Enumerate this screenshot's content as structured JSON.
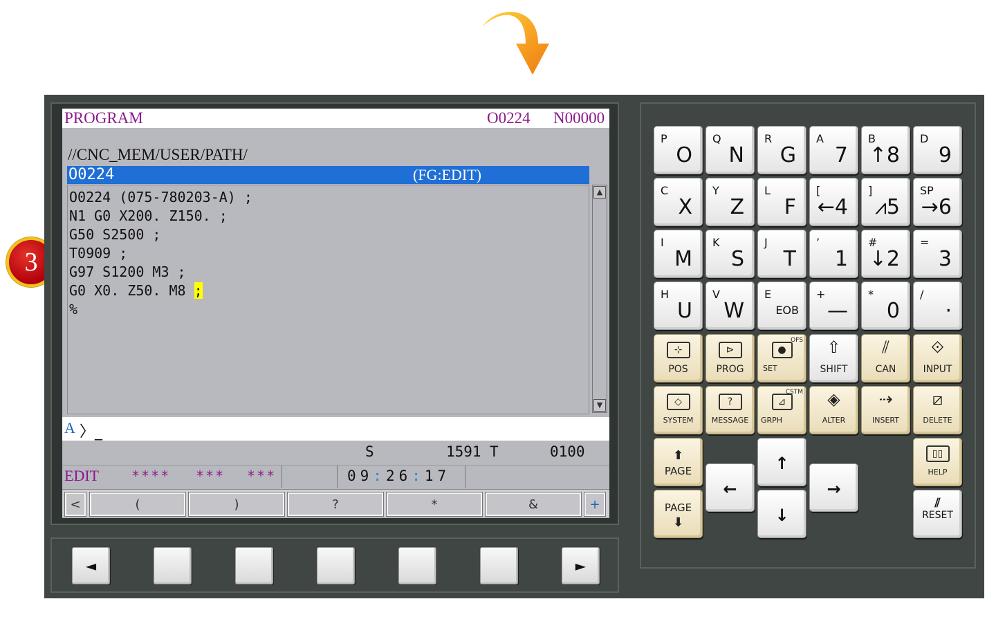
{
  "step_number": "3",
  "lcd": {
    "title": "PROGRAM",
    "o_number": "O0224",
    "n_number": "N00000",
    "path": "//CNC_MEM/USER/PATH/",
    "selected_program": "O0224",
    "mode_tag": "(FG:EDIT)",
    "code_lines": [
      "O0224 (075-780203-A) ;",
      "N1 G0 X200. Z150. ;",
      "G50 S2500 ;",
      "T0909 ;",
      "G97 S1200 M3 ;",
      "G0 X0. Z50. M8 ",
      "%"
    ],
    "cursor_char": ";",
    "input_prompt": "A",
    "input_rest": "〉_",
    "s_label": "S",
    "s_value": "1591",
    "t_label": "T",
    "t_value": "0100",
    "mode": "EDIT",
    "status_a": "****",
    "status_b": "***",
    "status_c": "***",
    "clock_h": "09",
    "clock_m": "26",
    "clock_s": "17",
    "soft_keys": [
      "<",
      "(",
      ")",
      "?",
      "*",
      "&",
      "+"
    ]
  },
  "hard_soft_keys": [
    "◄",
    "",
    "",
    "",
    "",
    "",
    "►"
  ],
  "keys": {
    "row1": [
      {
        "sub": "P",
        "main": "O"
      },
      {
        "sub": "Q",
        "main": "N"
      },
      {
        "sub": "R",
        "main": "G"
      },
      {
        "sub": "A",
        "main": "7"
      },
      {
        "sub": "B",
        "main": "↑8"
      },
      {
        "sub": "D",
        "main": "9"
      }
    ],
    "row2": [
      {
        "sub": "C",
        "main": "X"
      },
      {
        "sub": "Y",
        "main": "Z"
      },
      {
        "sub": "L",
        "main": "F"
      },
      {
        "sub": "[",
        "main": "←4"
      },
      {
        "sub": "]",
        "main": "⩘5"
      },
      {
        "sub": "SP",
        "main": "→6"
      }
    ],
    "row3": [
      {
        "sub": "I",
        "main": "M"
      },
      {
        "sub": "K",
        "main": "S"
      },
      {
        "sub": "J",
        "main": "T"
      },
      {
        "sub": "’",
        "main": "1"
      },
      {
        "sub": "#",
        "main": "↓2"
      },
      {
        "sub": "=",
        "main": "3"
      }
    ],
    "row4": [
      {
        "sub": "H",
        "main": "U"
      },
      {
        "sub": "V",
        "main": "W"
      },
      {
        "sub": "E",
        "main": "EOB"
      },
      {
        "sub": "+",
        "main": "—"
      },
      {
        "sub": "*",
        "main": "0"
      },
      {
        "sub": "/",
        "main": "·"
      }
    ],
    "func1": [
      "POS",
      "PROG",
      "SET",
      "SHIFT",
      "CAN",
      "INPUT"
    ],
    "func1_corner_ofs": "OFS",
    "func2": [
      "SYSTEM",
      "MESSAGE",
      "GRPH",
      "ALTER",
      "INSERT",
      "DELETE"
    ],
    "func2_corner_cstm": "CSTM",
    "page_up": "PAGE",
    "page_down": "PAGE",
    "help": "HELP",
    "reset": "RESET"
  },
  "colors": {
    "header_text": "#8b1a8b",
    "selection_bar": "#1f6fd6",
    "cursor_highlight": "#ffff00",
    "machine_body": "#3f4643",
    "function_key": "#efe4c5"
  }
}
